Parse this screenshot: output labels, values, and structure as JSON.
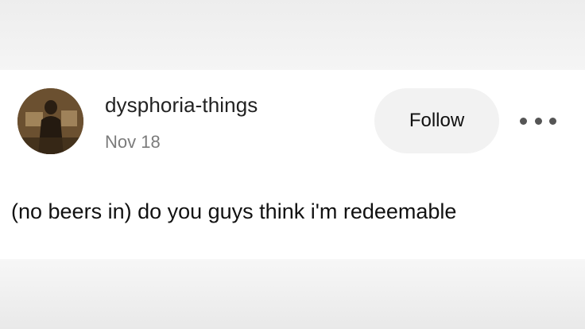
{
  "post": {
    "username": "dysphoria-things",
    "date": "Nov 18",
    "follow_label": "Follow",
    "body": "(no beers in) do you guys think i'm redeemable"
  },
  "icons": {
    "more": "more-horizontal-icon",
    "avatar": "avatar-image"
  }
}
